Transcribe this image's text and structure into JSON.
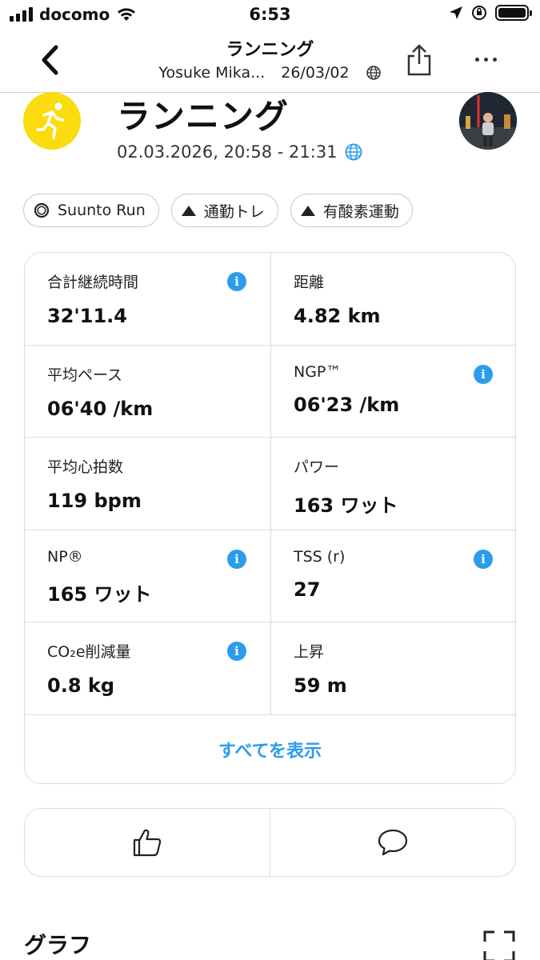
{
  "status_bar": {
    "carrier": "docomo",
    "time": "6:53"
  },
  "nav": {
    "title": "ランニング",
    "user": "Yosuke Mika...",
    "date": "26/03/02"
  },
  "header": {
    "title": "ランニング",
    "datetime": "02.03.2026, 20:58 - 21:31"
  },
  "tags": [
    {
      "icon": "watch-icon",
      "label": "Suunto Run"
    },
    {
      "icon": "triangle-icon",
      "label": "通勤トレ"
    },
    {
      "icon": "triangle-icon",
      "label": "有酸素運動"
    }
  ],
  "stats": [
    {
      "label": "合計継続時間",
      "value": "32'11.4",
      "info": true
    },
    {
      "label": "距離",
      "value": "4.82 km",
      "info": false
    },
    {
      "label": "平均ペース",
      "value": "06'40 /km",
      "info": false
    },
    {
      "label": "NGP™",
      "value": "06'23 /km",
      "info": true
    },
    {
      "label": "平均心拍数",
      "value": "119 bpm",
      "info": false
    },
    {
      "label": "パワー",
      "value": "163 ワット",
      "info": false
    },
    {
      "label": "NP®",
      "value": "165 ワット",
      "info": true
    },
    {
      "label": "TSS (r)",
      "value": "27",
      "info": true
    },
    {
      "label": "CO₂e削減量",
      "value": "0.8 kg",
      "info": true
    },
    {
      "label": "上昇",
      "value": "59 m",
      "info": false
    }
  ],
  "show_all_label": "すべてを表示",
  "graph_section_title": "グラフ",
  "colors": {
    "accent": "#2b9cec",
    "activity_icon_bg": "#fadc0f"
  }
}
